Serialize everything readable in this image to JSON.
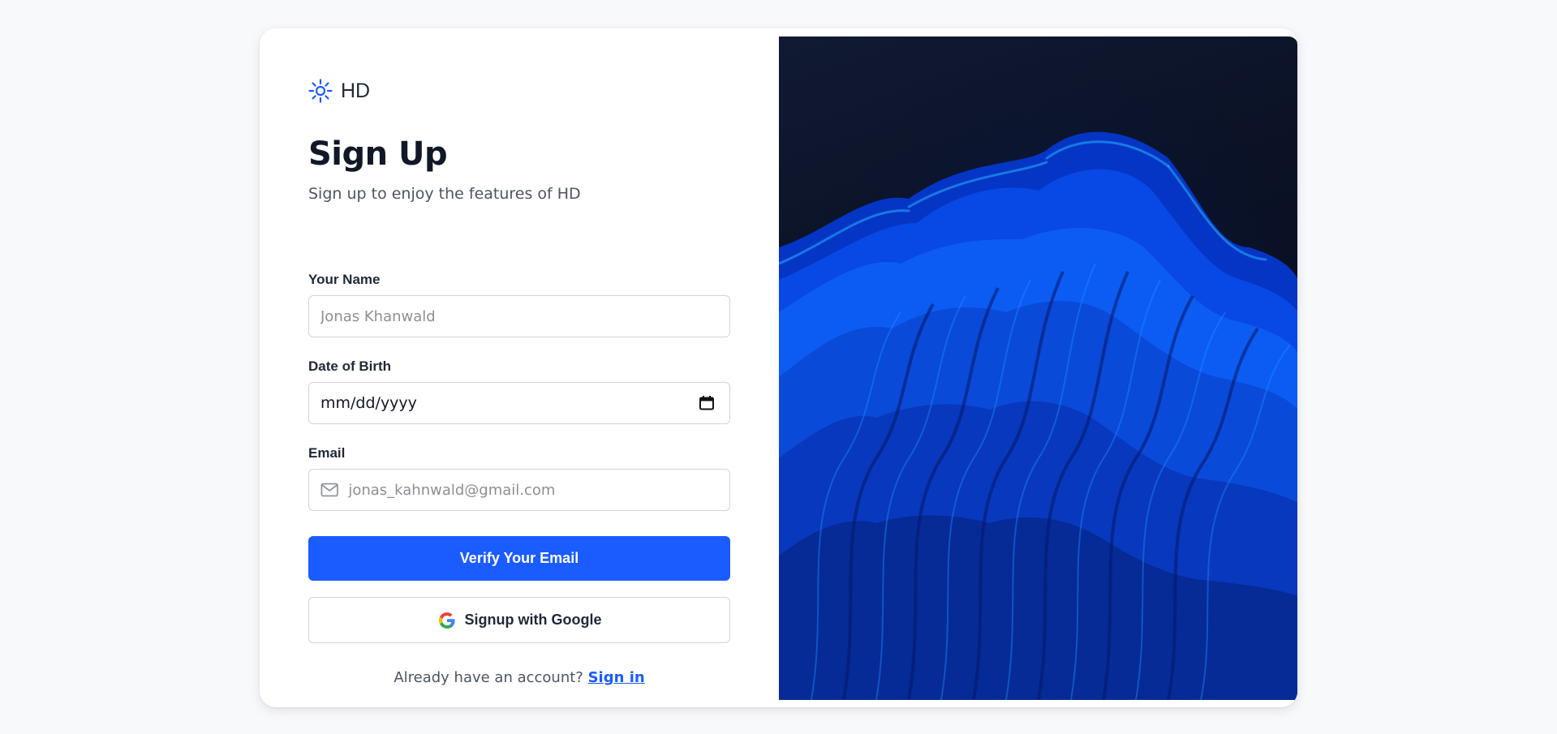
{
  "brand": {
    "icon": "sun-icon",
    "name": "HD",
    "accent_color": "#1a5cff"
  },
  "header": {
    "title": "Sign Up",
    "subtitle": "Sign up to enjoy the features of HD"
  },
  "form": {
    "name": {
      "label": "Your Name",
      "placeholder": "Jonas Khanwald",
      "value": ""
    },
    "dob": {
      "label": "Date of Birth",
      "display_value": "mm/dd/yyyy",
      "icon": "calendar-icon"
    },
    "email": {
      "label": "Email",
      "placeholder": "jonas_kahnwald@gmail.com",
      "value": "",
      "icon": "mail-icon"
    }
  },
  "actions": {
    "verify_label": "Verify Your Email",
    "verify_color": "#1a5cff",
    "google_label": "Signup with Google",
    "google_icon": "google-icon"
  },
  "footer": {
    "prompt": "Already have an account?",
    "link_label": "Sign in"
  },
  "hero": {
    "image": "abstract-blue-wave-image"
  }
}
